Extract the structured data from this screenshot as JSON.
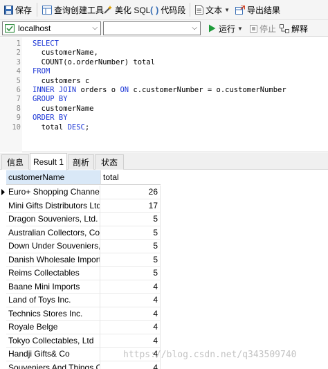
{
  "toolbar": {
    "save": "保存",
    "query_builder": "查询创建工具",
    "beautify": "美化 SQL",
    "code_snippet": "代码段",
    "text": "文本",
    "export": "导出结果"
  },
  "connection_bar": {
    "connection": "localhost",
    "database": "",
    "run": "运行",
    "stop": "停止",
    "explain": "解释"
  },
  "editor": {
    "lines": [
      {
        "n": "1",
        "kw": "SELECT",
        "rest": ""
      },
      {
        "n": "2",
        "kw": "",
        "rest": "  customerName,"
      },
      {
        "n": "3",
        "kw": "",
        "rest": "  COUNT(o.orderNumber) total"
      },
      {
        "n": "4",
        "kw": "FROM",
        "rest": ""
      },
      {
        "n": "5",
        "kw": "",
        "rest": "  customers c"
      },
      {
        "n": "6",
        "kw": "INNER JOIN",
        "rest": " orders o "
      },
      {
        "n": "7",
        "kw": "GROUP BY",
        "rest": ""
      },
      {
        "n": "8",
        "kw": "",
        "rest": "  customerName"
      },
      {
        "n": "9",
        "kw": "ORDER BY",
        "rest": ""
      },
      {
        "n": "10",
        "kw": "",
        "rest": "  total "
      }
    ],
    "line6_on": "ON",
    "line6_tail": " c.customerNumber = o.customerNumber",
    "line10_desc": "DESC",
    "line10_semicolon": ";"
  },
  "tabs": [
    "信息",
    "Result 1",
    "剖析",
    "状态"
  ],
  "result": {
    "columns": [
      "customerName",
      "total"
    ],
    "rows": [
      [
        "Euro+ Shopping Channel",
        "26"
      ],
      [
        "Mini Gifts Distributors Ltd",
        "17"
      ],
      [
        "Dragon Souveniers, Ltd.",
        "5"
      ],
      [
        "Australian Collectors, Co.",
        "5"
      ],
      [
        "Down Under Souveniers,",
        "5"
      ],
      [
        "Danish Wholesale Import",
        "5"
      ],
      [
        "Reims Collectables",
        "5"
      ],
      [
        "Baane Mini Imports",
        "4"
      ],
      [
        "Land of Toys Inc.",
        "4"
      ],
      [
        "Technics Stores Inc.",
        "4"
      ],
      [
        "Royale Belge",
        "4"
      ],
      [
        "Tokyo Collectables, Ltd",
        "4"
      ],
      [
        "Handji Gifts& Co",
        "4"
      ],
      [
        "Souveniers And Things Co",
        "4"
      ]
    ]
  },
  "watermark": "https://blog.csdn.net/q343509740",
  "colors": {
    "keyword": "#1f39d6",
    "selected_header": "#d9e8f7",
    "run_green": "#1e9b3a"
  }
}
